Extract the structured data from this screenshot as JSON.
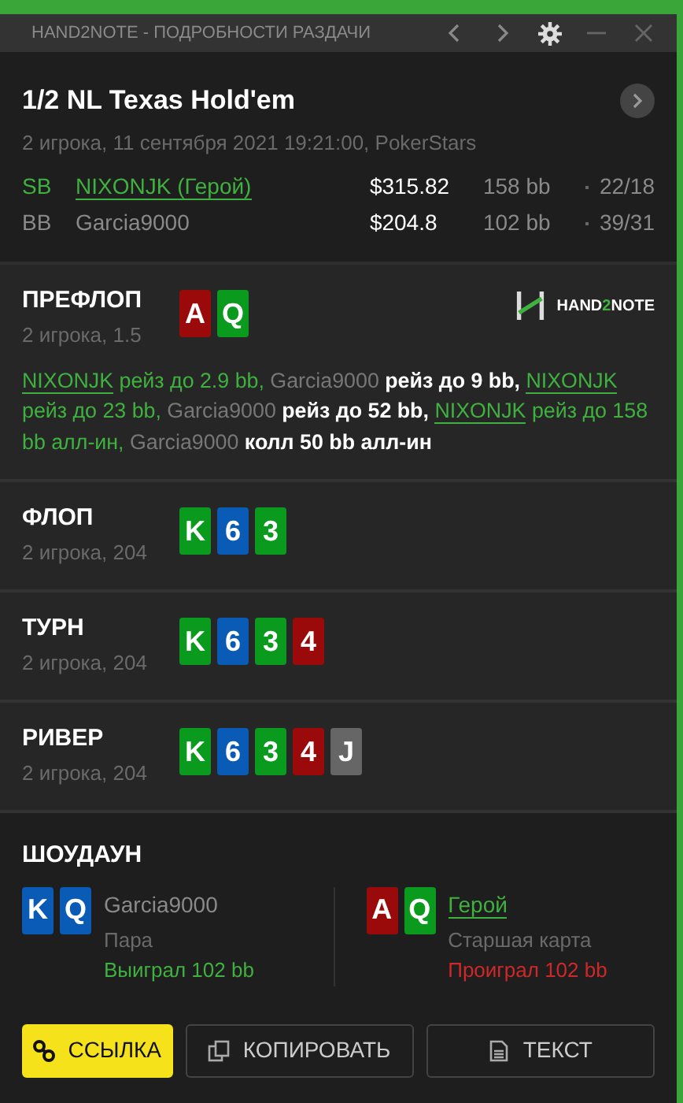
{
  "window": {
    "title": "HAND2NOTE - ПОДРОБНОСТИ РАЗДАЧИ"
  },
  "hand": {
    "title": "1/2 NL Texas Hold'em",
    "subtitle": "2 игрока, 11 сентября 2021 19:21:00, PokerStars"
  },
  "players": [
    {
      "position": "SB",
      "name": "NIXONJK (Герой)",
      "hero": true,
      "stack": "$315.82",
      "bb": "158 bb",
      "stats": "22/18"
    },
    {
      "position": "BB",
      "name": "Garcia9000",
      "hero": false,
      "stack": "$204.8",
      "bb": "102 bb",
      "stats": "39/31"
    }
  ],
  "streets": [
    {
      "title": "ПРЕФЛОП",
      "subtitle": "2 игрока, 1.5",
      "cards": [
        {
          "rank": "A",
          "color": "#9b0a0a"
        },
        {
          "rank": "Q",
          "color": "#0a9a1e"
        }
      ],
      "logo": {
        "prefix": "HAND",
        "mid": "2",
        "suffix": "NOTE"
      },
      "actions": [
        {
          "kind": "hero-name",
          "text": "NIXONJK"
        },
        {
          "kind": "hero-action",
          "text": " рейз до 2.9 bb, "
        },
        {
          "kind": "villain-name",
          "text": "Garcia9000"
        },
        {
          "kind": "villain-action",
          "text": " рейз до 9 bb, "
        },
        {
          "kind": "hero-name",
          "text": "NIXONJK"
        },
        {
          "kind": "hero-action",
          "text": " рейз до 23 bb, "
        },
        {
          "kind": "villain-name",
          "text": "Garcia9000"
        },
        {
          "kind": "villain-action",
          "text": " рейз до 52 bb, "
        },
        {
          "kind": "hero-name",
          "text": "NIXONJK"
        },
        {
          "kind": "hero-action",
          "text": " рейз до 158 bb алл-ин, "
        },
        {
          "kind": "villain-name",
          "text": "Garcia9000"
        },
        {
          "kind": "villain-action",
          "text": " колл 50 bb алл-ин"
        }
      ]
    },
    {
      "title": "ФЛОП",
      "subtitle": "2 игрока, 204",
      "cards": [
        {
          "rank": "K",
          "color": "#0a9a1e"
        },
        {
          "rank": "6",
          "color": "#0a5bb5"
        },
        {
          "rank": "3",
          "color": "#0a9a1e"
        }
      ]
    },
    {
      "title": "ТУРН",
      "subtitle": "2 игрока, 204",
      "cards": [
        {
          "rank": "K",
          "color": "#0a9a1e"
        },
        {
          "rank": "6",
          "color": "#0a5bb5"
        },
        {
          "rank": "3",
          "color": "#0a9a1e"
        },
        {
          "rank": "4",
          "color": "#9b0a0a"
        }
      ]
    },
    {
      "title": "РИВЕР",
      "subtitle": "2 игрока, 204",
      "cards": [
        {
          "rank": "K",
          "color": "#0a9a1e"
        },
        {
          "rank": "6",
          "color": "#0a5bb5"
        },
        {
          "rank": "3",
          "color": "#0a9a1e"
        },
        {
          "rank": "4",
          "color": "#9b0a0a"
        },
        {
          "rank": "J",
          "color": "#666666"
        }
      ]
    }
  ],
  "showdown": {
    "title": "ШОУДАУН",
    "hands": [
      {
        "name": "Garcia9000",
        "hero": false,
        "combo": "Пара",
        "result": "Выиграл 102 bb",
        "won": true,
        "cards": [
          {
            "rank": "K",
            "color": "#0a5bb5"
          },
          {
            "rank": "Q",
            "color": "#0a5bb5"
          }
        ]
      },
      {
        "name": "Герой",
        "hero": true,
        "combo": "Старшая карта",
        "result": "Проиграл 102 bb",
        "won": false,
        "cards": [
          {
            "rank": "A",
            "color": "#9b0a0a"
          },
          {
            "rank": "Q",
            "color": "#0a9a1e"
          }
        ]
      }
    ]
  },
  "buttons": [
    {
      "kind": "link",
      "label": "ССЫЛКА",
      "primary": true
    },
    {
      "kind": "copy",
      "label": "КОПИРОВАТЬ",
      "primary": false
    },
    {
      "kind": "text",
      "label": "ТЕКСТ",
      "primary": false
    }
  ]
}
